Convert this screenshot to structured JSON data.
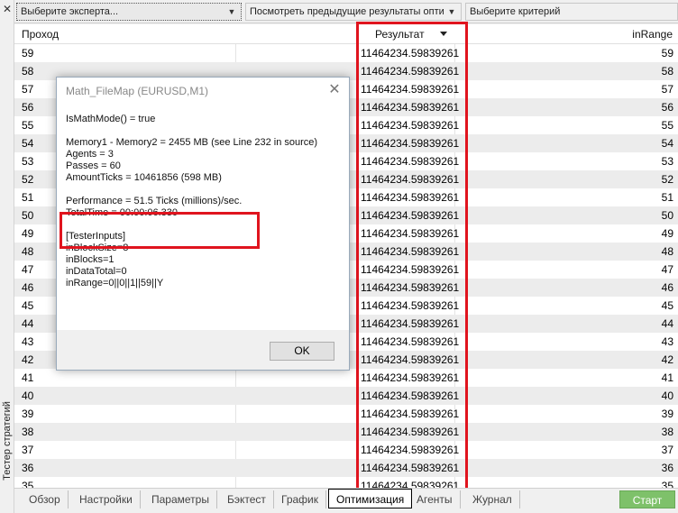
{
  "side_panel": {
    "close_glyph": "✕",
    "title": "Тестер стратегий"
  },
  "toolbar": {
    "expert_select": "Выберите эксперта...",
    "results_select": "Посмотреть предыдущие результаты оптим",
    "criterion_select": "Выберите критерий"
  },
  "table": {
    "headers": {
      "pass": "Проход",
      "result": "Результат",
      "range": "inRange"
    },
    "rows": [
      {
        "pass": "59",
        "result": "11464234.59839261",
        "range": "59"
      },
      {
        "pass": "58",
        "result": "11464234.59839261",
        "range": "58"
      },
      {
        "pass": "57",
        "result": "11464234.59839261",
        "range": "57"
      },
      {
        "pass": "56",
        "result": "11464234.59839261",
        "range": "56"
      },
      {
        "pass": "55",
        "result": "11464234.59839261",
        "range": "55"
      },
      {
        "pass": "54",
        "result": "11464234.59839261",
        "range": "54"
      },
      {
        "pass": "53",
        "result": "11464234.59839261",
        "range": "53"
      },
      {
        "pass": "52",
        "result": "11464234.59839261",
        "range": "52"
      },
      {
        "pass": "51",
        "result": "11464234.59839261",
        "range": "51"
      },
      {
        "pass": "50",
        "result": "11464234.59839261",
        "range": "50"
      },
      {
        "pass": "49",
        "result": "11464234.59839261",
        "range": "49"
      },
      {
        "pass": "48",
        "result": "11464234.59839261",
        "range": "48"
      },
      {
        "pass": "47",
        "result": "11464234.59839261",
        "range": "47"
      },
      {
        "pass": "46",
        "result": "11464234.59839261",
        "range": "46"
      },
      {
        "pass": "45",
        "result": "11464234.59839261",
        "range": "45"
      },
      {
        "pass": "44",
        "result": "11464234.59839261",
        "range": "44"
      },
      {
        "pass": "43",
        "result": "11464234.59839261",
        "range": "43"
      },
      {
        "pass": "42",
        "result": "11464234.59839261",
        "range": "42"
      },
      {
        "pass": "41",
        "result": "11464234.59839261",
        "range": "41"
      },
      {
        "pass": "40",
        "result": "11464234.59839261",
        "range": "40"
      },
      {
        "pass": "39",
        "result": "11464234.59839261",
        "range": "39"
      },
      {
        "pass": "38",
        "result": "11464234.59839261",
        "range": "38"
      },
      {
        "pass": "37",
        "result": "11464234.59839261",
        "range": "37"
      },
      {
        "pass": "36",
        "result": "11464234.59839261",
        "range": "36"
      },
      {
        "pass": "35",
        "result": "11464234.59839261",
        "range": "35"
      }
    ]
  },
  "tabs": [
    "Обзор",
    "Настройки",
    "Параметры",
    "Бэктест",
    "График",
    "Оптимизация",
    "Агенты",
    "Журнал"
  ],
  "active_tab": "Оптимизация",
  "start_button": "Старт",
  "dialog": {
    "title": "Math_FileMap (EURUSD,M1)",
    "close_glyph": "✕",
    "lines": [
      "IsMathMode() = true",
      "",
      "Memory1 - Memory2 = 2455 MB (see Line 232 in source)",
      "Agents = 3",
      "Passes = 60",
      "AmountTicks = 10461856 (598 MB)",
      "",
      "Performance = 51.5 Ticks (millions)/sec.",
      "TotalTime = 00:00:06.330",
      "",
      "[TesterInputs]",
      "inBlockSize=8",
      "inBlocks=1",
      "inDataTotal=0",
      "inRange=0||0||1||59||Y"
    ],
    "ok_button": "OK"
  },
  "colors": {
    "highlight": "#e0141e",
    "start_button": "#7ec16a",
    "row_alt": "#ececec"
  }
}
